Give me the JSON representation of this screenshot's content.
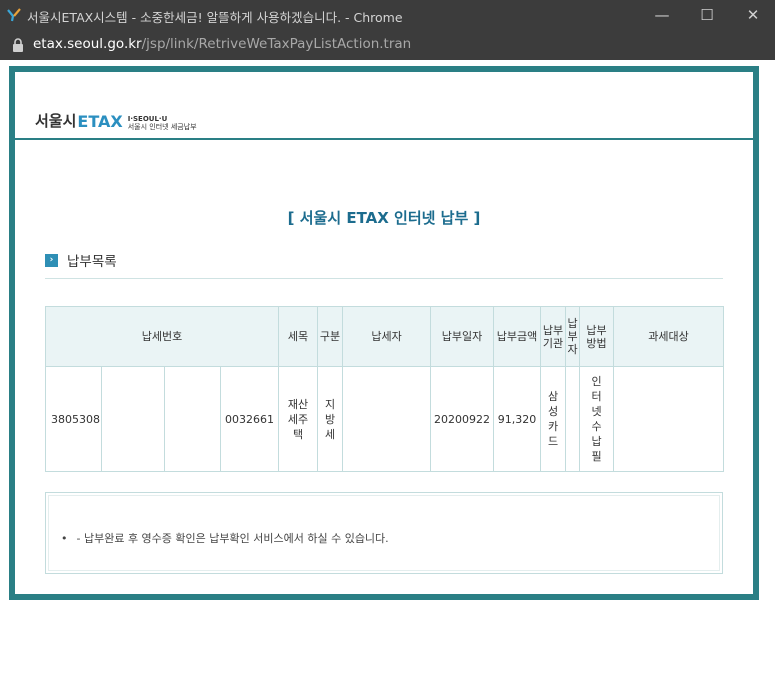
{
  "window": {
    "title": "서울시ETAX시스템 - 소중한세금! 알뜰하게 사용하겠습니다. - Chrome",
    "minimize_glyph": "—",
    "maximize_glyph": "☐",
    "close_glyph": "✕"
  },
  "address": {
    "host": "etax.seoul.go.kr",
    "path": "/jsp/link/RetriveWeTaxPayListAction.tran"
  },
  "brand": {
    "seoul": "서울시",
    "etax": "ETAX",
    "slogan_line1": "I·SEOUL·U",
    "slogan_line2": "서울시 인터넷 세금납부"
  },
  "page": {
    "title": "[ 서울시 ETAX 인터넷 납부 ]",
    "section_label": "납부목록",
    "section_icon": "arrow-right-icon"
  },
  "table": {
    "headers": {
      "tax_no": "납세번호",
      "item": "세목",
      "type": "구분",
      "payer": "납세자",
      "pay_date": "납부일자",
      "amount": "납부금액",
      "agency": "납부기관",
      "payer_short": "납부자",
      "method": "납부방법",
      "target": "과세대상"
    },
    "row": {
      "tax_no_1": "3805308",
      "tax_no_2": "",
      "tax_no_3": "",
      "tax_no_4": "0032661",
      "item": "재산세주택",
      "type": "지방세",
      "payer": "",
      "pay_date": "20200922",
      "amount": "91,320",
      "agency": "삼성카드",
      "payer_short": "",
      "method": "인터넷수납필",
      "target": ""
    }
  },
  "notice": {
    "text": "- 납부완료 후 영수증 확인은 납부확인 서비스에서 하실 수 있습니다."
  },
  "colors": {
    "frame": "#2a7f85",
    "header_bg": "#eaf4f5",
    "title": "#1c6c8e",
    "chrome_bar": "#3c3c3c"
  }
}
